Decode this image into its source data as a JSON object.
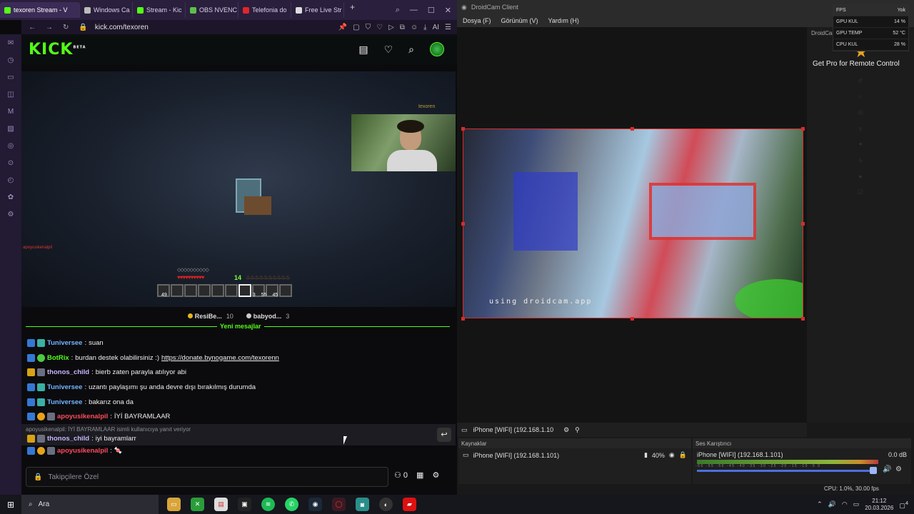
{
  "browser": {
    "tabs": [
      {
        "label": "texoren Stream - V",
        "color": "#53fc18",
        "active": true
      },
      {
        "label": "Windows Ca",
        "color": "#bbbbbb",
        "active": false
      },
      {
        "label": "Stream - Kic",
        "color": "#53fc18",
        "active": false
      },
      {
        "label": "OBS NVENC",
        "color": "#5bbf4a",
        "active": false
      },
      {
        "label": "Telefonia do",
        "color": "#e0262b",
        "active": false
      },
      {
        "label": "Free Live Str",
        "color": "#dddddd",
        "active": false
      }
    ],
    "url": "kick.com/texoren",
    "ai_label": "AI"
  },
  "kick": {
    "logo": "KICK",
    "beta": "BETA",
    "video": {
      "watermark": "texoren",
      "overlay_tag": "apoyusikenalpil",
      "xp_level": "14",
      "hotbar_counts": [
        "49",
        "3",
        "55",
        "45"
      ]
    },
    "leaderboard": [
      {
        "name": "ResiBe...",
        "count": "10"
      },
      {
        "name": "babyod...",
        "count": "3"
      }
    ],
    "new_messages": "Yeni mesajlar",
    "messages": [
      {
        "user": "Tuniversee",
        "user_class": "u-blue",
        "badges": [
          "b-blue",
          "b-cyan"
        ],
        "text": "suan"
      },
      {
        "user": "BotRix",
        "user_class": "u-green",
        "badges": [
          "b-blue",
          "b-green"
        ],
        "text": "burdan destek olabilirsiniz :) ",
        "link": "https://donate.bynogame.com/texorenn"
      },
      {
        "user": "thonos_child",
        "user_class": "u-lav",
        "badges": [
          "b-gold",
          "b-grey"
        ],
        "text": "bierb zaten parayla atılıyor abi"
      },
      {
        "user": "Tuniversee",
        "user_class": "u-blue",
        "badges": [
          "b-blue",
          "b-cyan"
        ],
        "text": "uzantı paylaşımı şu anda devre dışı bırakılmış durumda"
      },
      {
        "user": "Tuniversee",
        "user_class": "u-blue",
        "badges": [
          "b-blue",
          "b-cyan"
        ],
        "text": "bakarız ona da"
      },
      {
        "user": "apoyusikenalpil",
        "user_class": "u-red",
        "badges": [
          "b-blue",
          "b-orange",
          "b-grey"
        ],
        "text": "İYİ BAYRAMLAAR"
      }
    ],
    "reply": {
      "context": "apoyusikenalpil: İYİ BAYRAMLAAR isimli kullanıcıya yanıt veriyor",
      "user": "thonos_child",
      "text": "iyi bayramlarr"
    },
    "last_message": {
      "user": "apoyusikenalpil",
      "text": "🍬"
    },
    "chat_placeholder": "Takipçilere Özel",
    "points": "0"
  },
  "droidcam": {
    "title": "DroidCam Client",
    "menu": [
      "Dosya (F)",
      "Görünüm (V)",
      "Yardım (H)"
    ],
    "preview_label": "using droidcam.app",
    "get_pro": "Get Pro for Remote Control",
    "side_tag": "DroidCam",
    "stats": [
      {
        "label": "FPS",
        "value": "Yok"
      },
      {
        "label": "GPU KUL",
        "value": "14 %"
      },
      {
        "label": "GPU TEMP",
        "value": "52 °C"
      },
      {
        "label": "CPU KUL",
        "value": "28 %"
      }
    ],
    "source_bar": "iPhone [WIFI] (192.168.1.10",
    "sources_title": "Kaynaklar",
    "source_item": "iPhone [WIFI] (192.168.1.101)",
    "source_volume": "40%",
    "mixer_title": "Ses Karıştırıcı",
    "mixer_item": "iPhone [WIFI] (192.168.1.101)",
    "mixer_db": "0.0 dB",
    "mixer_ticks": "-60 -55 -50 -45 -40 -35 -30 -25 -20 -15 -10 -5 0",
    "status": "CPU: 1.0%, 30.00 fps"
  },
  "taskbar": {
    "search": "Ara",
    "time": "21:12",
    "date": "20.03.2026",
    "notifications": "4"
  }
}
